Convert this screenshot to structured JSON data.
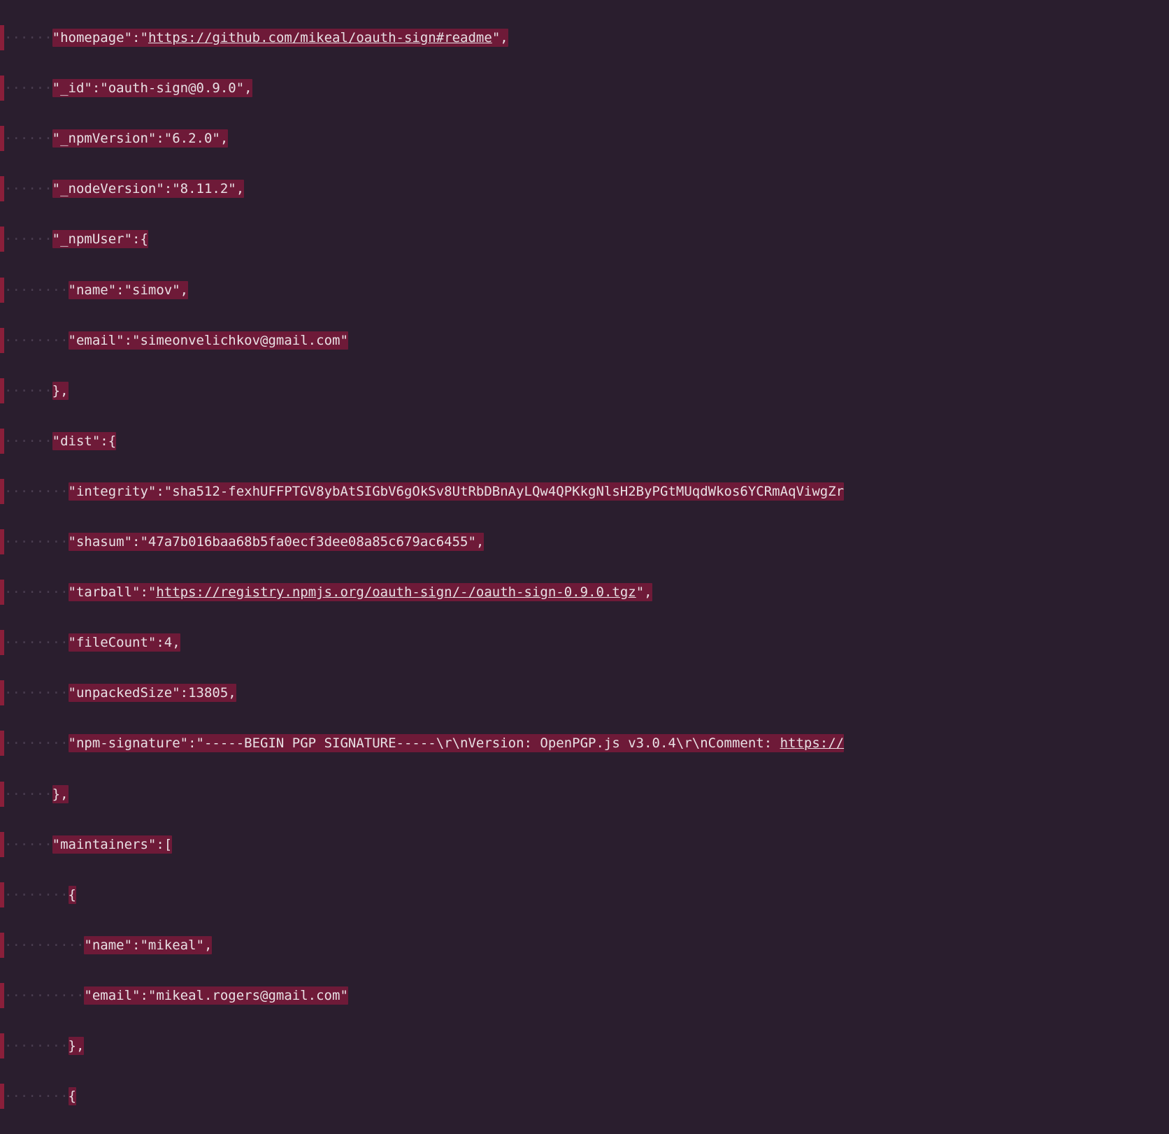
{
  "dots6": "······",
  "dots8": "········",
  "dots10": "··········",
  "dots12": "············",
  "lines": {
    "l0a": "\"",
    "l0b": "\":\"",
    "l0c": "https://github.com/mikeal/oauth-sign#readme",
    "l0d": "\",",
    "l1": "\"_id\":\"oauth-sign@0.9.0\",",
    "l2": "\"_npmVersion\":\"6.2.0\",",
    "l3": "\"_nodeVersion\":\"8.11.2\",",
    "l4": "\"_npmUser\":{",
    "l5": "\"name\":\"simov\",",
    "l6": "\"email\":\"simeonvelichkov@gmail.com\"",
    "l7": "},",
    "l8": "\"dist\":{",
    "l9": "\"integrity\":\"sha512-fexhUFFPTGV8ybAtSIGbV6gOkSv8UtRbDBnAyLQw4QPKkgNlsH2ByPGtMUqdWkos6YCRmAqViwgZr",
    "l10": "\"shasum\":\"47a7b016baa68b5fa0ecf3dee08a85c679ac6455\",",
    "l11a": "\"tarball\":\"",
    "l11b": "https://registry.npmjs.org/oauth-sign/-/oauth-sign-0.9.0.tgz",
    "l11c": "\",",
    "l12": "\"fileCount\":4,",
    "l13": "\"unpackedSize\":13805,",
    "l14a": "\"npm-signature\":\"-----BEGIN PGP SIGNATURE-----\\r\\nVersion: OpenPGP.js v3.0.4\\r\\nComment: ",
    "l14b": "https://",
    "l15": "},",
    "l16": "\"maintainers\":[",
    "l17": "{",
    "l18": "\"name\":\"mikeal\",",
    "l19": "\"email\":\"mikeal.rogers@gmail.com\"",
    "l20": "},",
    "l21": "{"
  }
}
